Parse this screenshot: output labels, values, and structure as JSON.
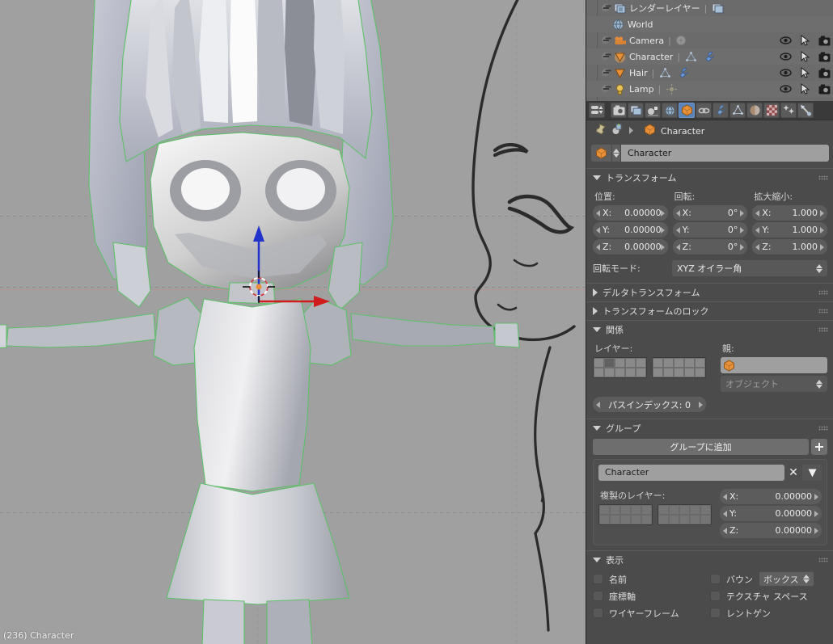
{
  "viewport": {
    "status_text": "(236) Character",
    "background_sketch": "character-side-profile-reference",
    "mesh_name": "low-poly-chibi-character",
    "selection_outline_color": "#5fbf6a",
    "background_color": "#a0a0a0",
    "axis_x_color": "#b89494",
    "cursor_3d": "3d-cursor",
    "manipulator": "translate-manipulator"
  },
  "outliner": {
    "rows": [
      {
        "label": "レンダーレイヤー",
        "icon": "render-layers-icon",
        "expandable": true,
        "sub_icons": [
          "render-layer-icon"
        ],
        "toggles": []
      },
      {
        "label": "World",
        "icon": "world-icon",
        "expandable": false,
        "sub_icons": [],
        "toggles": []
      },
      {
        "label": "Camera",
        "icon": "camera-object-icon",
        "expandable": true,
        "sub_icons": [
          "camera-data-icon"
        ],
        "toggles": [
          "eye-icon",
          "cursor-icon",
          "camera-icon"
        ]
      },
      {
        "label": "Character",
        "icon": "mesh-object-icon",
        "expandable": true,
        "sub_icons": [
          "mesh-data-icon",
          "modifier-wrench-icon"
        ],
        "toggles": [
          "eye-icon",
          "cursor-icon",
          "camera-icon"
        ]
      },
      {
        "label": "Hair",
        "icon": "mesh-object-icon",
        "expandable": true,
        "sub_icons": [
          "mesh-data-icon",
          "modifier-wrench-icon"
        ],
        "toggles": [
          "eye-icon",
          "cursor-icon",
          "camera-icon"
        ]
      },
      {
        "label": "Lamp",
        "icon": "lamp-object-icon",
        "expandable": true,
        "sub_icons": [
          "lamp-data-icon"
        ],
        "toggles": [
          "eye-icon",
          "cursor-icon",
          "camera-icon"
        ]
      }
    ]
  },
  "properties": {
    "tabs": [
      {
        "name": "render-tab",
        "icon": "camera-back-icon",
        "selected": false
      },
      {
        "name": "render-layers-tab",
        "icon": "render-layers-icon",
        "selected": false
      },
      {
        "name": "scene-tab",
        "icon": "scene-icon",
        "selected": false
      },
      {
        "name": "world-tab",
        "icon": "world-icon",
        "selected": false
      },
      {
        "name": "object-tab",
        "icon": "object-cube-icon",
        "selected": true
      },
      {
        "name": "constraints-tab",
        "icon": "chain-link-icon",
        "selected": false
      },
      {
        "name": "modifiers-tab",
        "icon": "wrench-icon",
        "selected": false
      },
      {
        "name": "object-data-tab",
        "icon": "mesh-data-icon",
        "selected": false
      },
      {
        "name": "material-tab",
        "icon": "material-sphere-icon",
        "selected": false
      },
      {
        "name": "texture-tab",
        "icon": "checker-texture-icon",
        "selected": false
      },
      {
        "name": "particles-tab",
        "icon": "particles-icon",
        "selected": false
      },
      {
        "name": "physics-tab",
        "icon": "physics-icon",
        "selected": false
      }
    ],
    "breadcrumb": {
      "pin_icon": "pin-icon",
      "browse_icon": "browse-id-icon",
      "object_icon": "object-cube-icon",
      "text": "Character"
    },
    "id_block": {
      "icon": "object-cube-icon",
      "name": "Character"
    },
    "transform": {
      "title": "トランスフォーム",
      "open": true,
      "location_label": "位置:",
      "rotation_label": "回転:",
      "scale_label": "拡大縮小:",
      "location": [
        {
          "axis": "X:",
          "value": "0.00000"
        },
        {
          "axis": "Y:",
          "value": "0.00000"
        },
        {
          "axis": "Z:",
          "value": "0.00000"
        }
      ],
      "rotation": [
        {
          "axis": "X:",
          "value": "0°"
        },
        {
          "axis": "Y:",
          "value": "0°"
        },
        {
          "axis": "Z:",
          "value": "0°"
        }
      ],
      "scale": [
        {
          "axis": "X:",
          "value": "1.000"
        },
        {
          "axis": "Y:",
          "value": "1.000"
        },
        {
          "axis": "Z:",
          "value": "1.000"
        }
      ],
      "rotation_mode_label": "回転モード:",
      "rotation_mode_value": "XYZ オイラー角"
    },
    "delta_transform": {
      "title": "デルタトランスフォーム",
      "open": false
    },
    "transform_lock": {
      "title": "トランスフォームのロック",
      "open": false
    },
    "relations": {
      "title": "関係",
      "open": true,
      "layers_label": "レイヤー:",
      "active_layer_index": 1,
      "parent_label": "親:",
      "parent_value": "",
      "parent_type_value": "オブジェクト",
      "pass_index_label": "パスインデックス:",
      "pass_index_value": "0"
    },
    "groups": {
      "title": "グループ",
      "open": true,
      "add_to_group_label": "グループに追加",
      "plus_icon": "plus-icon",
      "group_name": "Character",
      "remove_icon": "x-close-icon",
      "dupli_layers_label": "複製のレイヤー:",
      "offsets": [
        {
          "axis": "X:",
          "value": "0.00000"
        },
        {
          "axis": "Y:",
          "value": "0.00000"
        },
        {
          "axis": "Z:",
          "value": "0.00000"
        }
      ]
    },
    "display": {
      "title": "表示",
      "open": true,
      "checkboxes_left": [
        {
          "label": "名前",
          "checked": false
        },
        {
          "label": "座標軸",
          "checked": false
        },
        {
          "label": "ワイヤーフレーム",
          "checked": false
        }
      ],
      "checkboxes_right": [
        {
          "label": "バウン",
          "checked": false
        },
        {
          "label": "テクスチャ スペース",
          "checked": false
        },
        {
          "label": "レントゲン",
          "checked": false
        }
      ],
      "bounds_dropdown_value": "ボックス"
    }
  },
  "colors": {
    "accent_selected_tab": "#5b85b8",
    "panel_bg": "#4b4b4b",
    "outliner_bg": "#6b6b6b",
    "header_bg": "#3a3a3a",
    "field_bg": "#5c5c5c",
    "text_field_bg": "#9f9f9f",
    "object_icon_orange": "#e0883a"
  }
}
